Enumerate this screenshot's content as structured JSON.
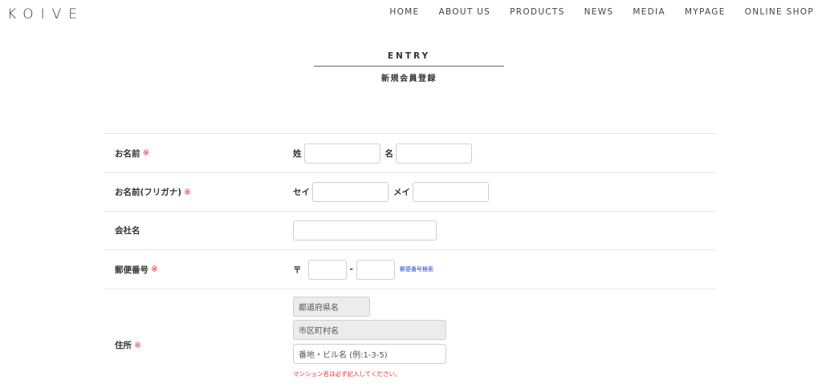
{
  "header": {
    "logo": "KOIVE",
    "nav": [
      "HOME",
      "ABOUT US",
      "PRODUCTS",
      "NEWS",
      "MEDIA",
      "MYPAGE",
      "ONLINE SHOP"
    ]
  },
  "page": {
    "title_en": "ENTRY",
    "title_jp": "新規会員登録"
  },
  "form": {
    "required_mark": "※",
    "name": {
      "label": "お名前",
      "last_label": "姓",
      "first_label": "名"
    },
    "kana": {
      "label": "お名前(フリガナ)",
      "last_label": "セイ",
      "first_label": "メイ"
    },
    "company": {
      "label": "会社名"
    },
    "postal": {
      "label": "郵便番号",
      "prefix": "〒",
      "dash": "-",
      "search_link": "郵便番号検索"
    },
    "address": {
      "label": "住所",
      "pref_placeholder": "都道府県名",
      "city_placeholder": "市区町村名",
      "street_placeholder": "番地・ビル名 (例:1-3-5)",
      "note": "マンション名は必ず記入してください。"
    }
  }
}
